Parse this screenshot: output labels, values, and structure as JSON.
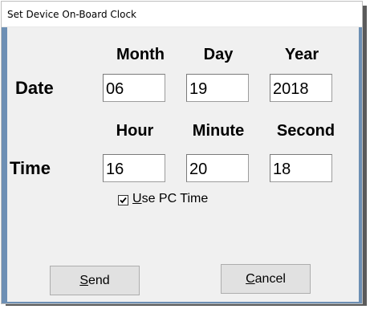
{
  "window": {
    "title": "Set Device On-Board Clock"
  },
  "date_section": {
    "row_label": "Date",
    "columns": [
      "Month",
      "Day",
      "Year"
    ],
    "values": [
      "06",
      "19",
      "2018"
    ]
  },
  "time_section": {
    "row_label": "Time",
    "columns": [
      "Hour",
      "Minute",
      "Second"
    ],
    "values": [
      "16",
      "20",
      "18"
    ]
  },
  "use_pc_time": {
    "mnemonic": "U",
    "rest": "se PC Time",
    "checked": true
  },
  "buttons": {
    "send": {
      "mnemonic": "S",
      "rest": "end"
    },
    "cancel": {
      "mnemonic": "C",
      "rest": "ancel"
    }
  }
}
